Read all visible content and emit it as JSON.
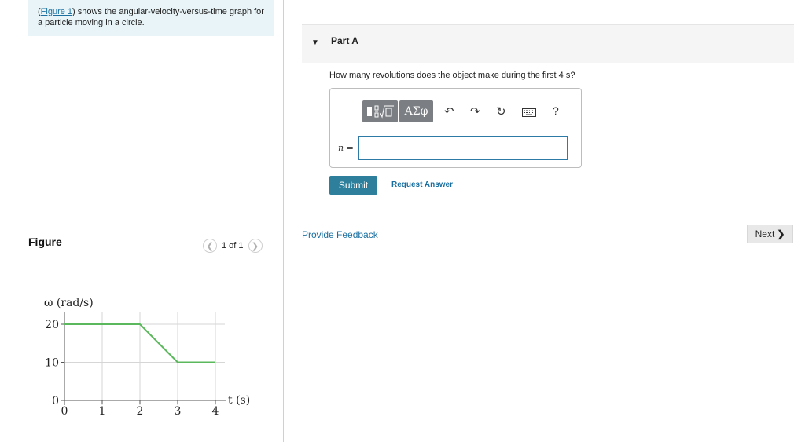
{
  "intro": {
    "paren_open": "(",
    "figure_link": "Figure 1",
    "rest": ") shows the angular-velocity-versus-time graph for a particle moving in a circle."
  },
  "figure": {
    "title": "Figure",
    "page_indicator": "1 of 1"
  },
  "chart_data": {
    "type": "line",
    "ylabel": "ω (rad/s)",
    "xlabel": "t (s)",
    "x": [
      0,
      2,
      3,
      4
    ],
    "y": [
      20,
      20,
      10,
      10
    ],
    "x_ticks": [
      "0",
      "1",
      "2",
      "3",
      "4"
    ],
    "y_ticks": [
      "0",
      "10",
      "20"
    ],
    "xlim": [
      0,
      4
    ],
    "ylim": [
      0,
      20
    ],
    "grid": true,
    "line_color": "#5cb85c"
  },
  "part_a": {
    "title": "Part A",
    "question": "How many revolutions does the object make during the first 4 s?",
    "toolbar": {
      "templates_icon": "fraction-sqrt-template-icon",
      "symbols_label": "ΑΣφ",
      "undo_icon": "undo-icon",
      "redo_icon": "redo-icon",
      "reset_icon": "reset-icon",
      "keyboard_icon": "keyboard-icon",
      "help_label": "?"
    },
    "variable_label": "n =",
    "input_value": "",
    "submit_label": "Submit",
    "request_answer_label": "Request Answer"
  },
  "footer": {
    "feedback_label": "Provide Feedback",
    "next_label": "Next"
  },
  "colors": {
    "accent": "#2d7f9c",
    "link": "#1a6fa0",
    "intro_bg": "#e8f4f8",
    "toolbar_button": "#7b7f83"
  }
}
